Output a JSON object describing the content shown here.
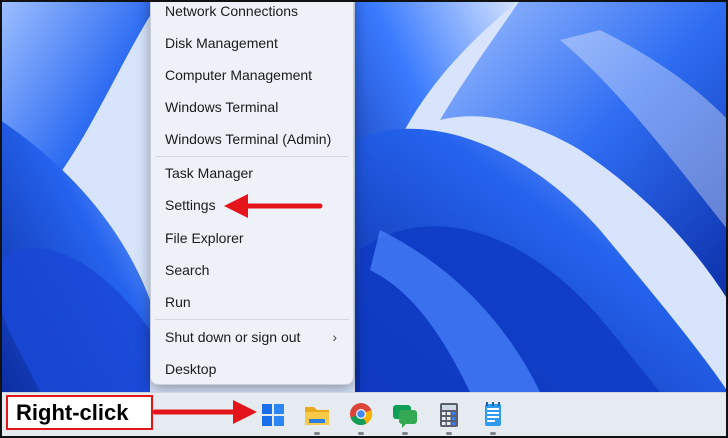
{
  "colors": {
    "wallpaper": "#1e4fd9",
    "menu_bg": "#eef1f7",
    "taskbar_bg": "#e6eaf1",
    "annotation_red": "#e4141b"
  },
  "context_menu": {
    "items": [
      {
        "label": "Network Connections"
      },
      {
        "label": "Disk Management"
      },
      {
        "label": "Computer Management"
      },
      {
        "label": "Windows Terminal"
      },
      {
        "label": "Windows Terminal (Admin)"
      },
      {
        "label": "Task Manager"
      },
      {
        "label": "Settings"
      },
      {
        "label": "File Explorer"
      },
      {
        "label": "Search"
      },
      {
        "label": "Run"
      },
      {
        "label": "Shut down or sign out",
        "submenu_icon": "chevron-right-icon"
      },
      {
        "label": "Desktop"
      }
    ]
  },
  "annotation": {
    "label": "Right-click"
  },
  "taskbar": {
    "icons": [
      "windows-start-icon",
      "file-explorer-icon",
      "chrome-icon",
      "messages-icon",
      "calculator-icon",
      "notepad-icon"
    ]
  }
}
